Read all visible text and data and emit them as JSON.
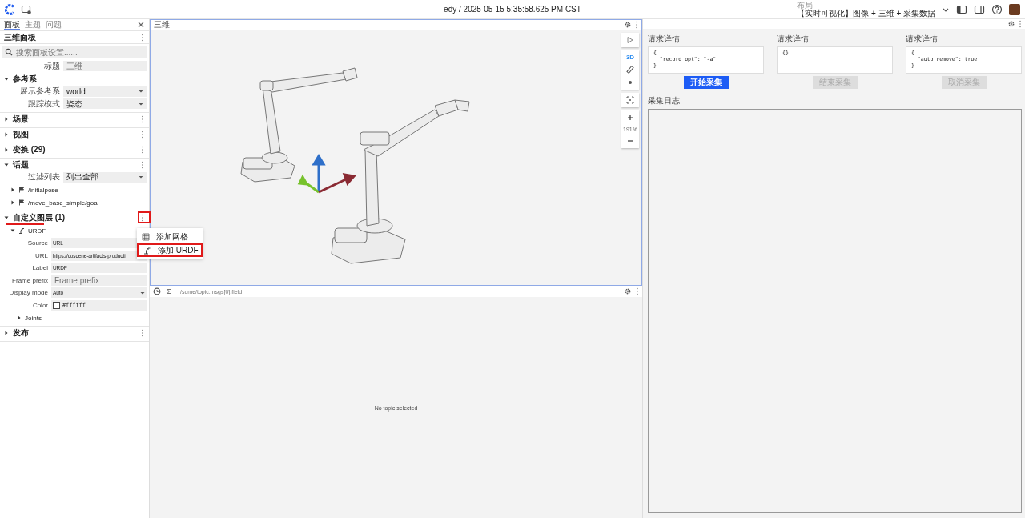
{
  "header": {
    "title": "edy / 2025-05-15 5:35:58.625 PM CST",
    "layout_caption": "布局",
    "layout_name": "【实时可视化】图像 + 三维 + 采集数据"
  },
  "sidebar": {
    "tabs": [
      {
        "label": "面板",
        "selected": true
      },
      {
        "label": "主题",
        "selected": false
      },
      {
        "label": "问题",
        "selected": false
      }
    ],
    "panel_title": "三维面板",
    "search_placeholder": "搜索面板设置......",
    "title_field": {
      "label": "标题",
      "placeholder": "三维"
    },
    "sections": [
      {
        "label": "参考系",
        "expanded": true,
        "fields": [
          {
            "label": "展示参考系",
            "value": "world",
            "kind": "select"
          },
          {
            "label": "跟踪模式",
            "value": "姿态",
            "kind": "select"
          }
        ]
      },
      {
        "label": "场景",
        "expanded": false
      },
      {
        "label": "视图",
        "expanded": false
      },
      {
        "label": "变换 (29)",
        "expanded": false
      },
      {
        "label": "话题",
        "expanded": true,
        "fields": [
          {
            "label": "过滤列表",
            "value": "列出全部",
            "kind": "select"
          }
        ],
        "topics": [
          {
            "label": "/initialpose",
            "expanded": false
          },
          {
            "label": "/move_base_simple/goal",
            "expanded": false
          }
        ]
      },
      {
        "label": "自定义图层 (1)",
        "expanded": true,
        "highlighted": true,
        "layers": [
          {
            "label": "URDF",
            "expanded": true,
            "fields": [
              {
                "label": "Source",
                "value": "URL",
                "kind": "text"
              },
              {
                "label": "URL",
                "value": "https://coscene-artifacts-producti",
                "kind": "text"
              },
              {
                "label": "Label",
                "value": "URDF",
                "kind": "text"
              },
              {
                "label": "Frame prefix",
                "placeholder": "Frame prefix",
                "kind": "text"
              },
              {
                "label": "Display mode",
                "value": "Auto",
                "kind": "select"
              },
              {
                "label": "Color",
                "value": "#ffffff",
                "kind": "color"
              }
            ],
            "children": [
              {
                "label": "Joints",
                "expanded": false
              }
            ]
          }
        ]
      },
      {
        "label": "发布",
        "expanded": false
      }
    ]
  },
  "menu": {
    "items": [
      {
        "label": "添加网格",
        "kind": "grid",
        "highlighted": false
      },
      {
        "label": "添加 URDF",
        "kind": "urdf",
        "highlighted": true
      }
    ]
  },
  "viewport": {
    "title": "三维",
    "mode_label": "3D",
    "zoom": "191%"
  },
  "plot": {
    "path_placeholder": "/some/topic.msgs[0].field",
    "empty_message": "No topic selected"
  },
  "services": [
    {
      "caption": "请求详情",
      "body": "{\n  \"record_opt\": \"-a\"\n}",
      "button": "开始采集",
      "disabled": false
    },
    {
      "caption": "请求详情",
      "body": "{}",
      "button": "结束采集",
      "disabled": true
    },
    {
      "caption": "请求详情",
      "body": "{\n  \"auto_remove\": true\n}",
      "button": "取消采集",
      "disabled": true
    }
  ],
  "log_label": "采集日志"
}
